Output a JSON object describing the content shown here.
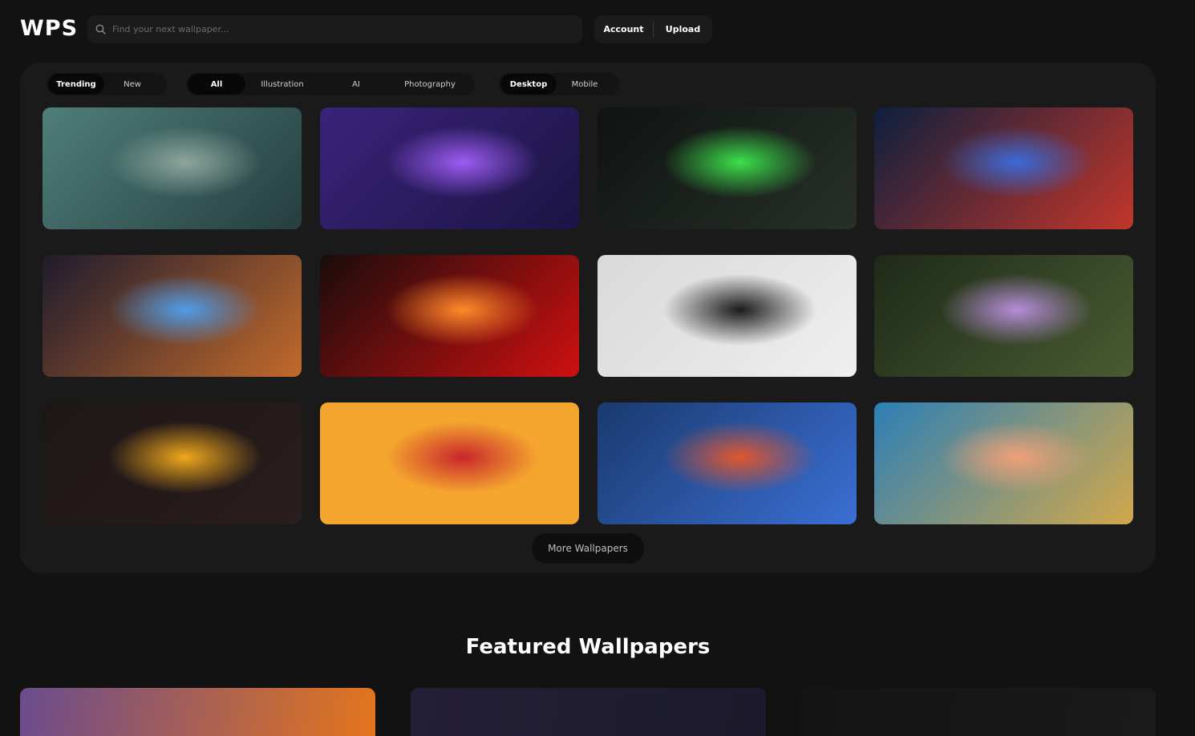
{
  "header": {
    "logo": "WPS",
    "search_placeholder": "Find your next wallpaper...",
    "account_label": "Account",
    "upload_label": "Upload"
  },
  "filters": {
    "sort": [
      "Trending",
      "New"
    ],
    "sort_active": "Trending",
    "category": [
      "All",
      "Illustration",
      "AI",
      "Photography"
    ],
    "category_active": "All",
    "device": [
      "Desktop",
      "Mobile"
    ],
    "device_active": "Desktop"
  },
  "wallpapers": [
    {
      "subject": "kraken-sea-storm",
      "colors": [
        "#4f7e7a",
        "#253e3f",
        "#8ea69c"
      ]
    },
    {
      "subject": "neon-palm-leaves",
      "colors": [
        "#3a237a",
        "#1b1444",
        "#9c5cf2"
      ]
    },
    {
      "subject": "warriors-green-slash",
      "colors": [
        "#0f1312",
        "#273028",
        "#3ce04a"
      ]
    },
    {
      "subject": "cosmic-red-nebula",
      "colors": [
        "#0c1f3e",
        "#c2362a",
        "#3a6ad8"
      ]
    },
    {
      "subject": "retro-gamer-room",
      "colors": [
        "#1e1b2c",
        "#c26a2c",
        "#4f9ce8"
      ]
    },
    {
      "subject": "anime-red-moon-girl",
      "colors": [
        "#1a0c0c",
        "#cf1010",
        "#ff8a2a"
      ]
    },
    {
      "subject": "samurai-ink-stroke",
      "colors": [
        "#d9d9d9",
        "#efefef",
        "#1b1b1b"
      ]
    },
    {
      "subject": "astronaut-flower-field",
      "colors": [
        "#1e2a18",
        "#4a5b32",
        "#b68cd8"
      ]
    },
    {
      "subject": "vhs-lightning-girl",
      "colors": [
        "#1e1616",
        "#2a1d1d",
        "#f0a81c"
      ]
    },
    {
      "subject": "pocky-witch-girl",
      "colors": [
        "#f5a62e",
        "#f5a62e",
        "#c8262c"
      ]
    },
    {
      "subject": "gothic-castle-blood-moon",
      "colors": [
        "#1a3a6e",
        "#3b6fd4",
        "#e0562e"
      ]
    },
    {
      "subject": "icelandic-waterfall-mountain",
      "colors": [
        "#2c7fb7",
        "#d2a84a",
        "#f0a07a"
      ]
    }
  ],
  "more_label": "More Wallpapers",
  "featured": {
    "title": "Featured Wallpapers",
    "items": [
      {
        "subject": "anime-purple-orange",
        "colors": [
          "#6a4b8e",
          "#e4751c"
        ]
      },
      {
        "subject": "night-sky-dark",
        "colors": [
          "#241f38",
          "#1c1a2b"
        ]
      },
      {
        "subject": "dark-shadow",
        "colors": [
          "#141414",
          "#1a1a1a"
        ]
      }
    ]
  }
}
